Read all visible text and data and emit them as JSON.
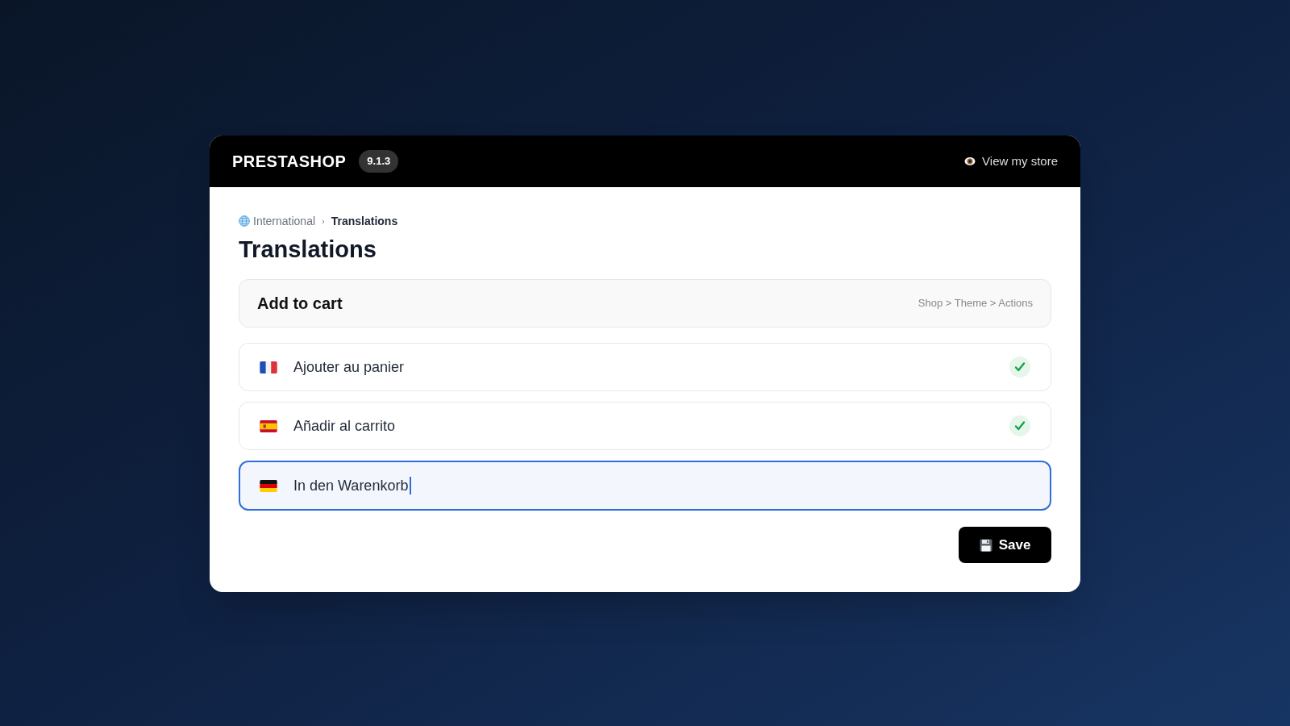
{
  "header": {
    "logo": "PRESTASHOP",
    "version": "9.1.3",
    "store_link": "View my store"
  },
  "breadcrumb": [
    {
      "label": "International",
      "current": false
    },
    {
      "label": "Translations",
      "current": true
    }
  ],
  "separator": "›",
  "title": "Translations",
  "source": {
    "text": "Add to cart",
    "path": "Shop > Theme > Actions"
  },
  "translations": [
    {
      "kind": "france",
      "text": "Ajouter au panier",
      "verified": true,
      "selected": false
    },
    {
      "kind": "spain",
      "text": "Añadir al carrito",
      "verified": true,
      "selected": false
    },
    {
      "kind": "germany",
      "text": "In den Warenkorb",
      "verified": false,
      "selected": true
    }
  ],
  "save_button": "Save"
}
